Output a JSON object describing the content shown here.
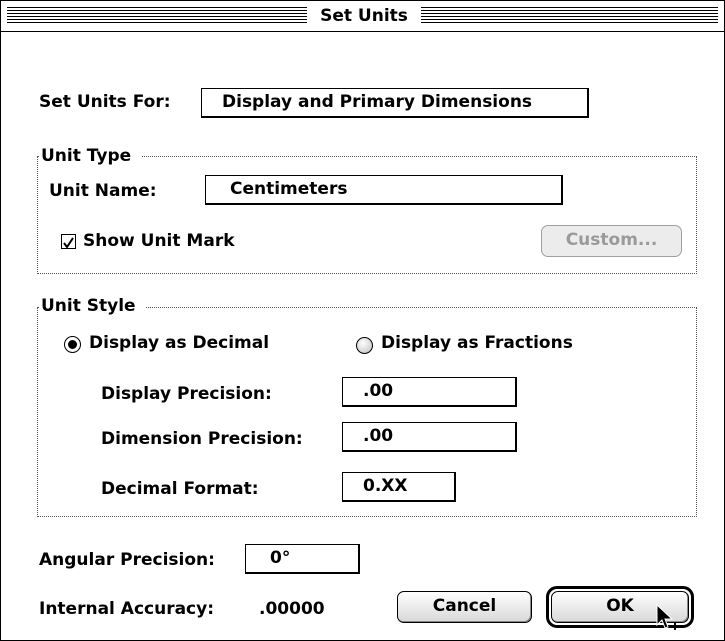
{
  "window": {
    "title": "Set Units"
  },
  "set_units_for": {
    "label": "Set Units For:",
    "value": "Display and Primary Dimensions"
  },
  "unit_type": {
    "legend": "Unit Type",
    "unit_name_label": "Unit Name:",
    "unit_name_value": "Centimeters",
    "show_unit_mark_label": "Show Unit Mark",
    "show_unit_mark_checked": true,
    "custom_button": "Custom..."
  },
  "unit_style": {
    "legend": "Unit Style",
    "radio_decimal_label": "Display as Decimal",
    "radio_fractions_label": "Display as Fractions",
    "selected": "decimal",
    "display_precision_label": "Display Precision:",
    "display_precision_value": ".00",
    "dimension_precision_label": "Dimension Precision:",
    "dimension_precision_value": ".00",
    "decimal_format_label": "Decimal Format:",
    "decimal_format_value": "0.XX"
  },
  "angular_precision": {
    "label": "Angular Precision:",
    "value": "0°"
  },
  "internal_accuracy": {
    "label": "Internal Accuracy:",
    "value": ".00000"
  },
  "buttons": {
    "cancel": "Cancel",
    "ok": "OK"
  },
  "icons": {
    "cursor": "arrow-pointer-with-plus-icon",
    "checkbox": "checkmark-icon"
  }
}
